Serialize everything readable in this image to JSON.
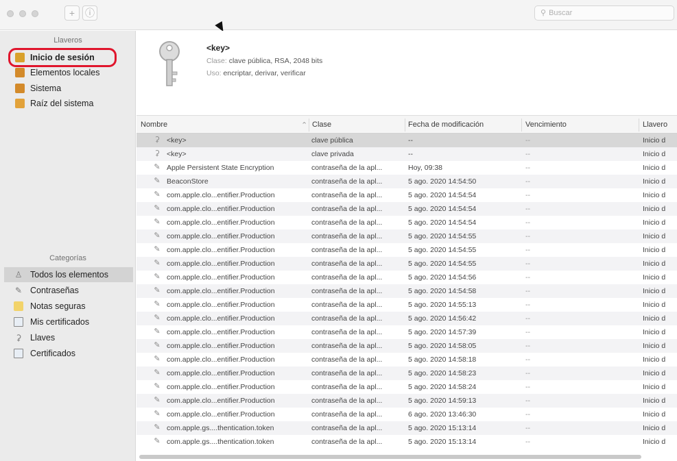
{
  "toolbar": {
    "add_label": "+",
    "info_label": "ⓘ",
    "search_placeholder": "Buscar",
    "search_icon": "magnifier-icon"
  },
  "sidebar": {
    "keychains_header": "Llaveros",
    "keychains": [
      {
        "label": "Inicio de sesión",
        "icon": "lock-icon"
      },
      {
        "label": "Elementos locales",
        "icon": "lock-icon"
      },
      {
        "label": "Sistema",
        "icon": "lock-icon"
      },
      {
        "label": "Raíz del sistema",
        "icon": "folder-icon"
      }
    ],
    "categories_header": "Categorías",
    "categories": [
      {
        "label": "Todos los elementos",
        "icon": "people-icon"
      },
      {
        "label": "Contraseñas",
        "icon": "pencil-icon"
      },
      {
        "label": "Notas seguras",
        "icon": "note-icon"
      },
      {
        "label": "Mis certificados",
        "icon": "certificate-icon"
      },
      {
        "label": "Llaves",
        "icon": "key-icon"
      },
      {
        "label": "Certificados",
        "icon": "certificate-icon"
      }
    ]
  },
  "info": {
    "title": "<key>",
    "class_key": "Clase:",
    "class_value": "clave pública, RSA, 2048 bits",
    "use_key": "Uso:",
    "use_value": "encriptar, derivar, verificar"
  },
  "table": {
    "columns": [
      "Nombre",
      "Clase",
      "Fecha de modificación",
      "Vencimiento",
      "Llavero"
    ],
    "sort_indicator": "⌃",
    "rows": [
      {
        "icon": "key",
        "name": "<key>",
        "class": "clave pública",
        "date": "--",
        "exp": "--",
        "chain": "Inicio d"
      },
      {
        "icon": "key",
        "name": "<key>",
        "class": "clave privada",
        "date": "--",
        "exp": "--",
        "chain": "Inicio d"
      },
      {
        "icon": "pen",
        "name": "Apple Persistent State Encryption",
        "class": "contraseña de la apl...",
        "date": "Hoy, 09:38",
        "exp": "--",
        "chain": "Inicio d"
      },
      {
        "icon": "pen",
        "name": "BeaconStore",
        "class": "contraseña de la apl...",
        "date": "5 ago. 2020 14:54:50",
        "exp": "--",
        "chain": "Inicio d"
      },
      {
        "icon": "pen",
        "name": "com.apple.clo...entifier.Production",
        "class": "contraseña de la apl...",
        "date": "5 ago. 2020 14:54:54",
        "exp": "--",
        "chain": "Inicio d"
      },
      {
        "icon": "pen",
        "name": "com.apple.clo...entifier.Production",
        "class": "contraseña de la apl...",
        "date": "5 ago. 2020 14:54:54",
        "exp": "--",
        "chain": "Inicio d"
      },
      {
        "icon": "pen",
        "name": "com.apple.clo...entifier.Production",
        "class": "contraseña de la apl...",
        "date": "5 ago. 2020 14:54:54",
        "exp": "--",
        "chain": "Inicio d"
      },
      {
        "icon": "pen",
        "name": "com.apple.clo...entifier.Production",
        "class": "contraseña de la apl...",
        "date": "5 ago. 2020 14:54:55",
        "exp": "--",
        "chain": "Inicio d"
      },
      {
        "icon": "pen",
        "name": "com.apple.clo...entifier.Production",
        "class": "contraseña de la apl...",
        "date": "5 ago. 2020 14:54:55",
        "exp": "--",
        "chain": "Inicio d"
      },
      {
        "icon": "pen",
        "name": "com.apple.clo...entifier.Production",
        "class": "contraseña de la apl...",
        "date": "5 ago. 2020 14:54:55",
        "exp": "--",
        "chain": "Inicio d"
      },
      {
        "icon": "pen",
        "name": "com.apple.clo...entifier.Production",
        "class": "contraseña de la apl...",
        "date": "5 ago. 2020 14:54:56",
        "exp": "--",
        "chain": "Inicio d"
      },
      {
        "icon": "pen",
        "name": "com.apple.clo...entifier.Production",
        "class": "contraseña de la apl...",
        "date": "5 ago. 2020 14:54:58",
        "exp": "--",
        "chain": "Inicio d"
      },
      {
        "icon": "pen",
        "name": "com.apple.clo...entifier.Production",
        "class": "contraseña de la apl...",
        "date": "5 ago. 2020 14:55:13",
        "exp": "--",
        "chain": "Inicio d"
      },
      {
        "icon": "pen",
        "name": "com.apple.clo...entifier.Production",
        "class": "contraseña de la apl...",
        "date": "5 ago. 2020 14:56:42",
        "exp": "--",
        "chain": "Inicio d"
      },
      {
        "icon": "pen",
        "name": "com.apple.clo...entifier.Production",
        "class": "contraseña de la apl...",
        "date": "5 ago. 2020 14:57:39",
        "exp": "--",
        "chain": "Inicio d"
      },
      {
        "icon": "pen",
        "name": "com.apple.clo...entifier.Production",
        "class": "contraseña de la apl...",
        "date": "5 ago. 2020 14:58:05",
        "exp": "--",
        "chain": "Inicio d"
      },
      {
        "icon": "pen",
        "name": "com.apple.clo...entifier.Production",
        "class": "contraseña de la apl...",
        "date": "5 ago. 2020 14:58:18",
        "exp": "--",
        "chain": "Inicio d"
      },
      {
        "icon": "pen",
        "name": "com.apple.clo...entifier.Production",
        "class": "contraseña de la apl...",
        "date": "5 ago. 2020 14:58:23",
        "exp": "--",
        "chain": "Inicio d"
      },
      {
        "icon": "pen",
        "name": "com.apple.clo...entifier.Production",
        "class": "contraseña de la apl...",
        "date": "5 ago. 2020 14:58:24",
        "exp": "--",
        "chain": "Inicio d"
      },
      {
        "icon": "pen",
        "name": "com.apple.clo...entifier.Production",
        "class": "contraseña de la apl...",
        "date": "5 ago. 2020 14:59:13",
        "exp": "--",
        "chain": "Inicio d"
      },
      {
        "icon": "pen",
        "name": "com.apple.clo...entifier.Production",
        "class": "contraseña de la apl...",
        "date": "6 ago. 2020 13:46:30",
        "exp": "--",
        "chain": "Inicio d"
      },
      {
        "icon": "pen",
        "name": "com.apple.gs....thentication.token",
        "class": "contraseña de la apl...",
        "date": "5 ago. 2020 15:13:14",
        "exp": "--",
        "chain": "Inicio d"
      },
      {
        "icon": "pen",
        "name": "com.apple.gs....thentication.token",
        "class": "contraseña de la apl...",
        "date": "5 ago. 2020 15:13:14",
        "exp": "--",
        "chain": "Inicio d"
      }
    ]
  },
  "colors": {
    "highlight_ring": "#e0152c",
    "selected_row": "#d7d7d7"
  }
}
